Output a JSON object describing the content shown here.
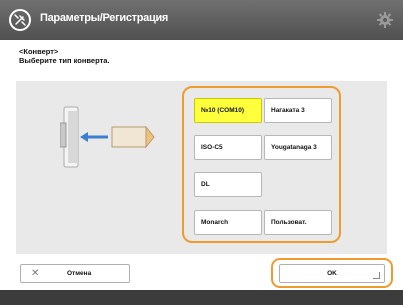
{
  "header": {
    "title": "Параметры/Регистрация",
    "title_icon": "wrench-gear-icon",
    "settings_icon": "gear-icon"
  },
  "instruction": {
    "line1": "<Конверт>",
    "line2": "Выберите тип конверта."
  },
  "envelope_options": [
    {
      "label": "№10 (COM10)",
      "selected": true
    },
    {
      "label": "Нагаката 3",
      "selected": false
    },
    {
      "label": "ISO-C5",
      "selected": false
    },
    {
      "label": "Yougatanaga 3",
      "selected": false
    },
    {
      "label": "DL",
      "selected": false
    },
    {
      "label": "",
      "selected": false
    },
    {
      "label": "Monarch",
      "selected": false
    },
    {
      "label": "Пользоват.",
      "selected": false
    }
  ],
  "footer": {
    "cancel_label": "Отмена",
    "ok_label": "OK"
  },
  "colors": {
    "selected": "#ffff3c",
    "focus_ring": "#ee9c2f",
    "arrow": "#3a7fd0",
    "titlebar": "#5a5a5a"
  }
}
